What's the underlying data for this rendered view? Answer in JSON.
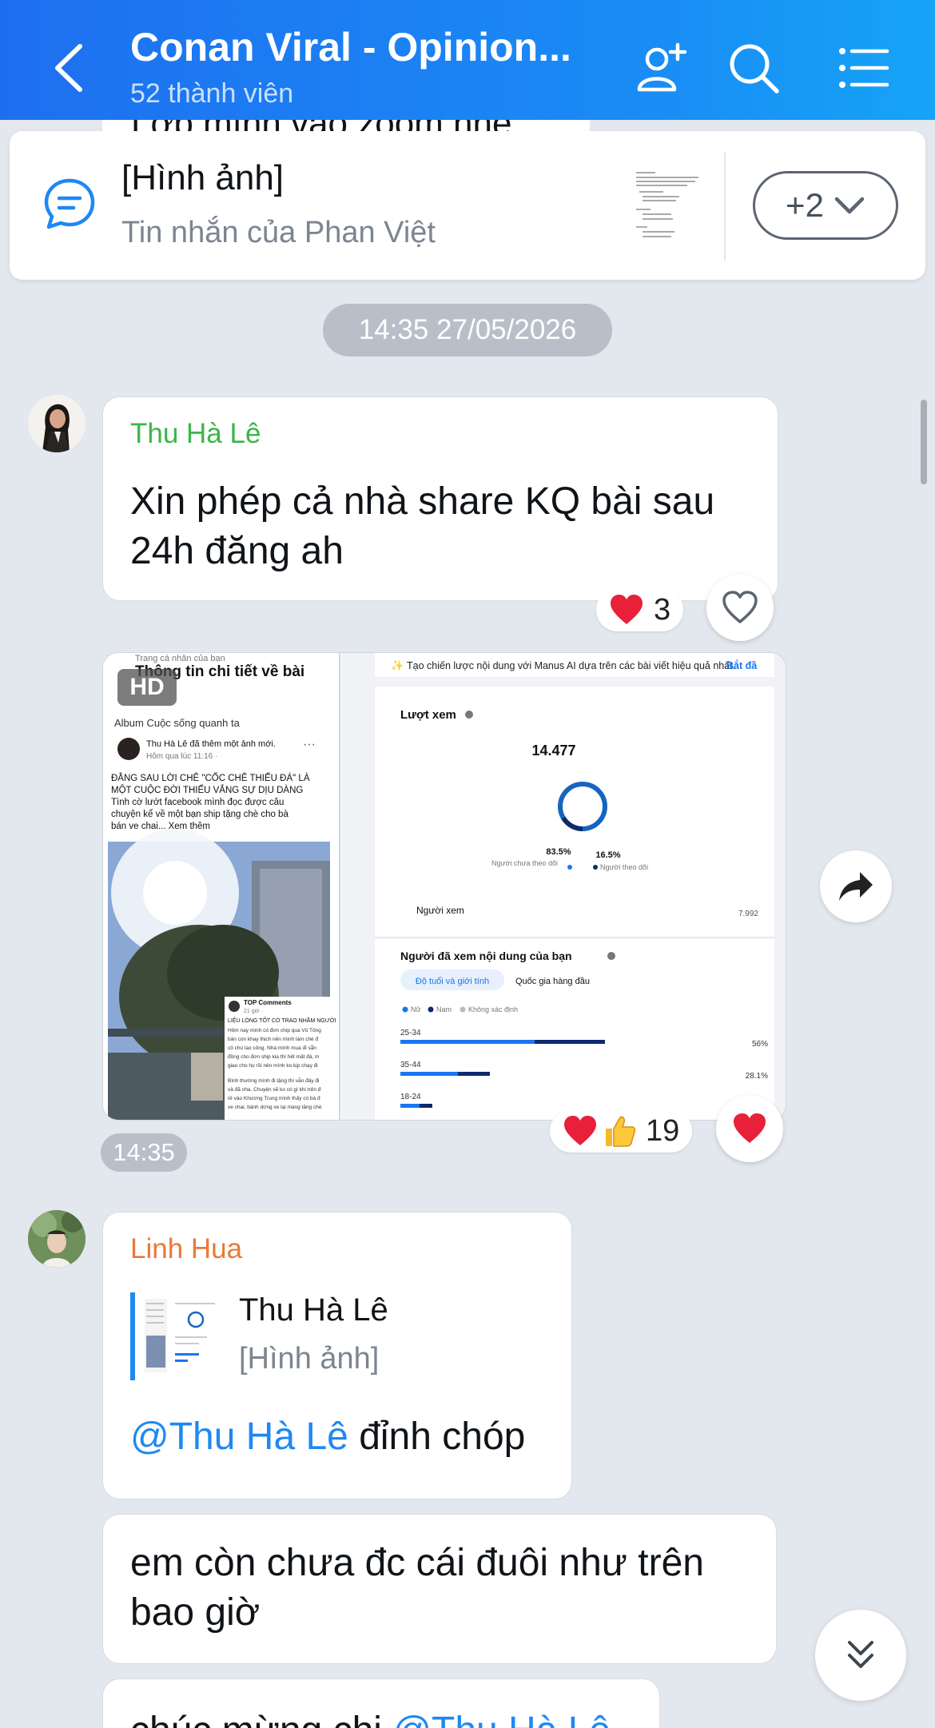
{
  "header": {
    "title": "Conan Viral - Opinion...",
    "members": "52 thành viên"
  },
  "peek_text": "Lớp mình vào zoom nhé",
  "pinned": {
    "title": "[Hình ảnh]",
    "subtitle": "Tin nhắn của Phan Việt",
    "more": "+2"
  },
  "time_divider": "14:35 27/05/2026",
  "messages": [
    {
      "sender": "Thu Hà Lê",
      "sender_color": "#3ab54a",
      "lines": [
        "Xin phép cả nhà share KQ bài sau",
        "24h đăng ah"
      ],
      "reaction_count": "3"
    },
    {
      "type": "image",
      "badge": "HD",
      "time": "14:35",
      "reaction_count": "19",
      "fb": {
        "back_caption": "Trang cá nhân của bạn",
        "header": "Thông tin chi tiết về bài",
        "album": "Album Cuộc sống quanh ta",
        "author_line": "Thu Hà Lê đã thêm một ảnh mới.",
        "time_line": "Hôm qua lúc 11:16 · ",
        "post_text": [
          "ĐẰNG SAU LỜI CHÊ \"CỐC CHÊ THIẾU ĐÁ\" LÀ",
          "MỘT CUỘC ĐỜI THIẾU VẮNG SỰ DỊU DÀNG",
          "Tình cờ lướt facebook mình đọc được câu",
          "chuyện kể về một bạn ship tặng chè cho bà",
          "bán ve chai... Xem thêm"
        ],
        "top_comments": "TOP Comments",
        "top_sub": "21 giờ · ",
        "comment_head": "LIỆU LÒNG TỐT CÓ TRAO NHẦM NGƯỜI",
        "comment_lines": [
          "Hôm nay mình có đơn chip qua Vũ Tông",
          "bản còn khay thịch nên mình làm chè đ",
          "cô chú lao công. Nhà mình mua đi sẵn",
          "đồng cho đơn ship kia thì hết mất đá, m",
          "giao cho họ rồi nên mình ko kịp chạy đi",
          "Bình thường mình đi tặng thì vẫn đây đi",
          "và đã nha. Chuyện sẽ ko có gì khi trên đ",
          "rê vào Khương Trung mình thấy có bà đ",
          "ve chai, bánh dứng xe lại mang tặng chè"
        ],
        "manus_line": "Tạo chiến lược nội dung với Manus AI dựa trên các bài viết hiệu quả nhất.",
        "manus_link": "Bắt đầ",
        "views_label": "Lượt xem",
        "views_value": "14.477",
        "pct_non": "83.5%",
        "pct_follow": "16.5%",
        "legend_non": "Người chưa theo dõi",
        "legend_follow": "Người theo dõi",
        "viewers_label": "Người xem",
        "viewers_value": "7.992",
        "who_viewed": "Người đã xem nội dung của bạn",
        "tab_age": "Độ tuổi và giới tính",
        "tab_country": "Quốc gia hàng đầu",
        "leg_nu": "Nữ",
        "leg_nam": "Nam",
        "leg_unknown": "Không xác định",
        "ages": [
          {
            "label": "25-34",
            "pct": "56%",
            "female": 0.42,
            "male": 0.22
          },
          {
            "label": "35-44",
            "pct": "28.1%",
            "female": 0.18,
            "male": 0.1
          },
          {
            "label": "18-24",
            "pct": "",
            "female": 0.06,
            "male": 0.04
          }
        ],
        "donut_follow_fraction": 0.165
      }
    },
    {
      "sender": "Linh Hua",
      "sender_color": "#e8793a",
      "quote_name": "Thu Hà Lê",
      "quote_text": "[Hình ảnh]",
      "mention": "@Thu Hà Lê",
      "text_after": " đỉnh chóp"
    },
    {
      "lines": [
        "em còn chưa đc cái đuôi như trên",
        "bao giờ"
      ]
    },
    {
      "text_before": "chúc mừng chị ",
      "mention": "@Thu Hà Lê"
    }
  ],
  "icons": [
    "back-chevron-icon",
    "add-member-icon",
    "search-icon",
    "menu-list-icon",
    "chat-bubble-icon",
    "chevron-down-icon",
    "heart-icon",
    "thumbs-up-icon",
    "share-forward-icon",
    "double-chevron-down-icon"
  ]
}
